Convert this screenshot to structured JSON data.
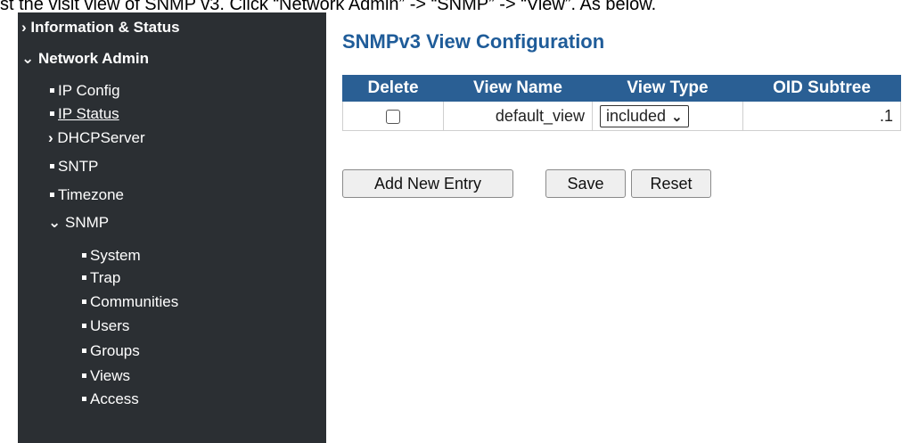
{
  "caption": "st the visit view of SNMP v3. Click “Network Admin” -> “SNMP” -> “View”. As below.",
  "sidebar": {
    "items": [
      {
        "label": "Information & Status",
        "glyph": "›"
      },
      {
        "label": "Network Admin",
        "glyph": "⌄"
      },
      {
        "label": "IP Config"
      },
      {
        "label": "IP Status"
      },
      {
        "label": "DHCPServer",
        "glyph": "›"
      },
      {
        "label": "SNTP"
      },
      {
        "label": "Timezone"
      },
      {
        "label": "SNMP",
        "glyph": "⌄"
      },
      {
        "label": "System"
      },
      {
        "label": "Trap"
      },
      {
        "label": "Communities"
      },
      {
        "label": "Users"
      },
      {
        "label": "Groups"
      },
      {
        "label": "Views"
      },
      {
        "label": "Access"
      }
    ]
  },
  "main": {
    "title": "SNMPv3 View Configuration",
    "table": {
      "headers": [
        "Delete",
        "View Name",
        "View Type",
        "OID Subtree"
      ],
      "rows": [
        {
          "view_name": "default_view",
          "view_type": "included",
          "oid_subtree": ".1"
        }
      ]
    },
    "buttons": {
      "add_new_entry": "Add New Entry",
      "save": "Save",
      "reset": "Reset"
    }
  },
  "colors": {
    "sidebar_bg": "#2b2f33",
    "header_bg": "#2a5f94",
    "title": "#1f5c99"
  }
}
